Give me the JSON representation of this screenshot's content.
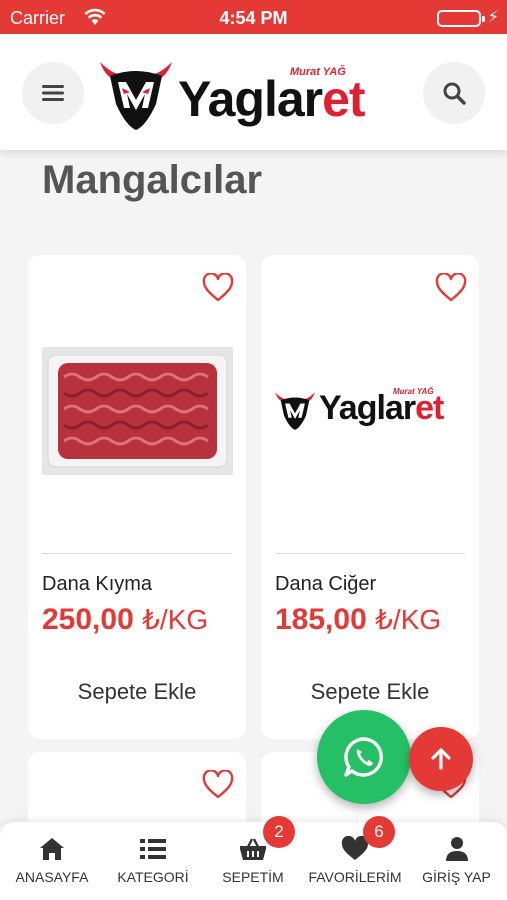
{
  "status_bar": {
    "carrier": "Carrier",
    "time": "4:54 PM"
  },
  "header": {
    "menu_icon": "hamburger-menu-icon",
    "search_icon": "search-icon",
    "logo": {
      "tagline": "Murat YAĞ",
      "wordmark_main": "Yaglar",
      "wordmark_accent": "et"
    }
  },
  "page": {
    "title": "Mangalcılar"
  },
  "products": [
    {
      "name": "Dana Kıyma",
      "price": "250,00",
      "unit": "₺/KG",
      "add_to_cart": "Sepete Ekle",
      "image": "ground-beef-photo"
    },
    {
      "name": "Dana Ciğer",
      "price": "185,00",
      "unit": "₺/KG",
      "add_to_cart": "Sepete Ekle",
      "image": "yaglaret-logo-placeholder"
    }
  ],
  "floating": {
    "whatsapp_icon": "whatsapp-icon",
    "scroll_top_icon": "arrow-up-icon"
  },
  "bottom_nav": {
    "items": [
      {
        "label": "ANASAYFA",
        "icon": "home-icon"
      },
      {
        "label": "KATEGORİ",
        "icon": "list-icon"
      },
      {
        "label": "SEPETİM",
        "icon": "basket-icon",
        "badge": "2"
      },
      {
        "label": "FAVORİLERİM",
        "icon": "heart-icon",
        "badge": "6"
      },
      {
        "label": "GİRİŞ YAP",
        "icon": "user-icon"
      }
    ]
  },
  "colors": {
    "brand_red": "#e53935",
    "whatsapp_green": "#25c065",
    "title_gray": "#555555"
  }
}
